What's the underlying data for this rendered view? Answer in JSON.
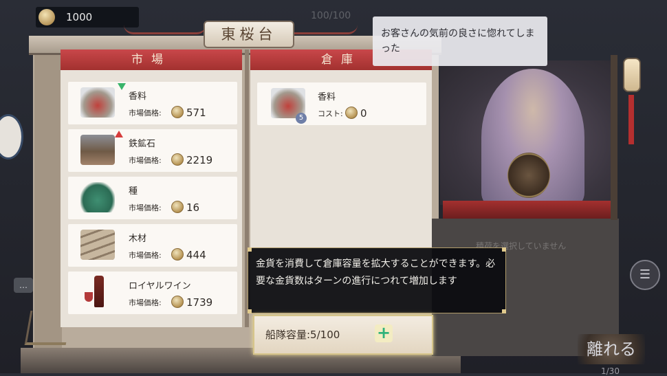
{
  "top_bar": {
    "gold": "1000",
    "dim_counter": "100/100"
  },
  "title": "東桜台",
  "market": {
    "header": "市場",
    "items": [
      {
        "name": "香料",
        "price_label": "市場価格:",
        "price": "571",
        "trend": "down",
        "icon": "spice-bowl-icon"
      },
      {
        "name": "鉄鉱石",
        "price_label": "市場価格:",
        "price": "2219",
        "trend": "up",
        "icon": "iron-ore-crate-icon"
      },
      {
        "name": "種",
        "price_label": "市場価格:",
        "price": "16",
        "trend": "none",
        "icon": "seed-sack-icon"
      },
      {
        "name": "木材",
        "price_label": "市場価格:",
        "price": "444",
        "trend": "none",
        "icon": "timber-logs-icon"
      },
      {
        "name": "ロイヤルワイン",
        "price_label": "市場価格:",
        "price": "1739",
        "trend": "none",
        "icon": "wine-bottle-icon"
      }
    ]
  },
  "warehouse": {
    "header": "倉庫",
    "items": [
      {
        "name": "香料",
        "cost_label": "コスト:",
        "cost": "0",
        "quantity_badge": "5",
        "icon": "spice-bowl-icon"
      }
    ]
  },
  "npc": {
    "speech": "お客さんの気前の良さに惚れてしまった",
    "empty_hint": "積荷を選択していません"
  },
  "tooltip": {
    "text": "金貨を消費して倉庫容量を拡大することができます。必要な金貨数はターンの進行につれて増加します"
  },
  "capacity": {
    "text": "船隊容量:5/100",
    "expand_symbol": "+"
  },
  "leave_button": "離れる",
  "page_counter": "1/30",
  "colors": {
    "header_red": "#b0383a",
    "expand_green": "#2fb27a",
    "tooltip_border": "#b29d6a"
  }
}
